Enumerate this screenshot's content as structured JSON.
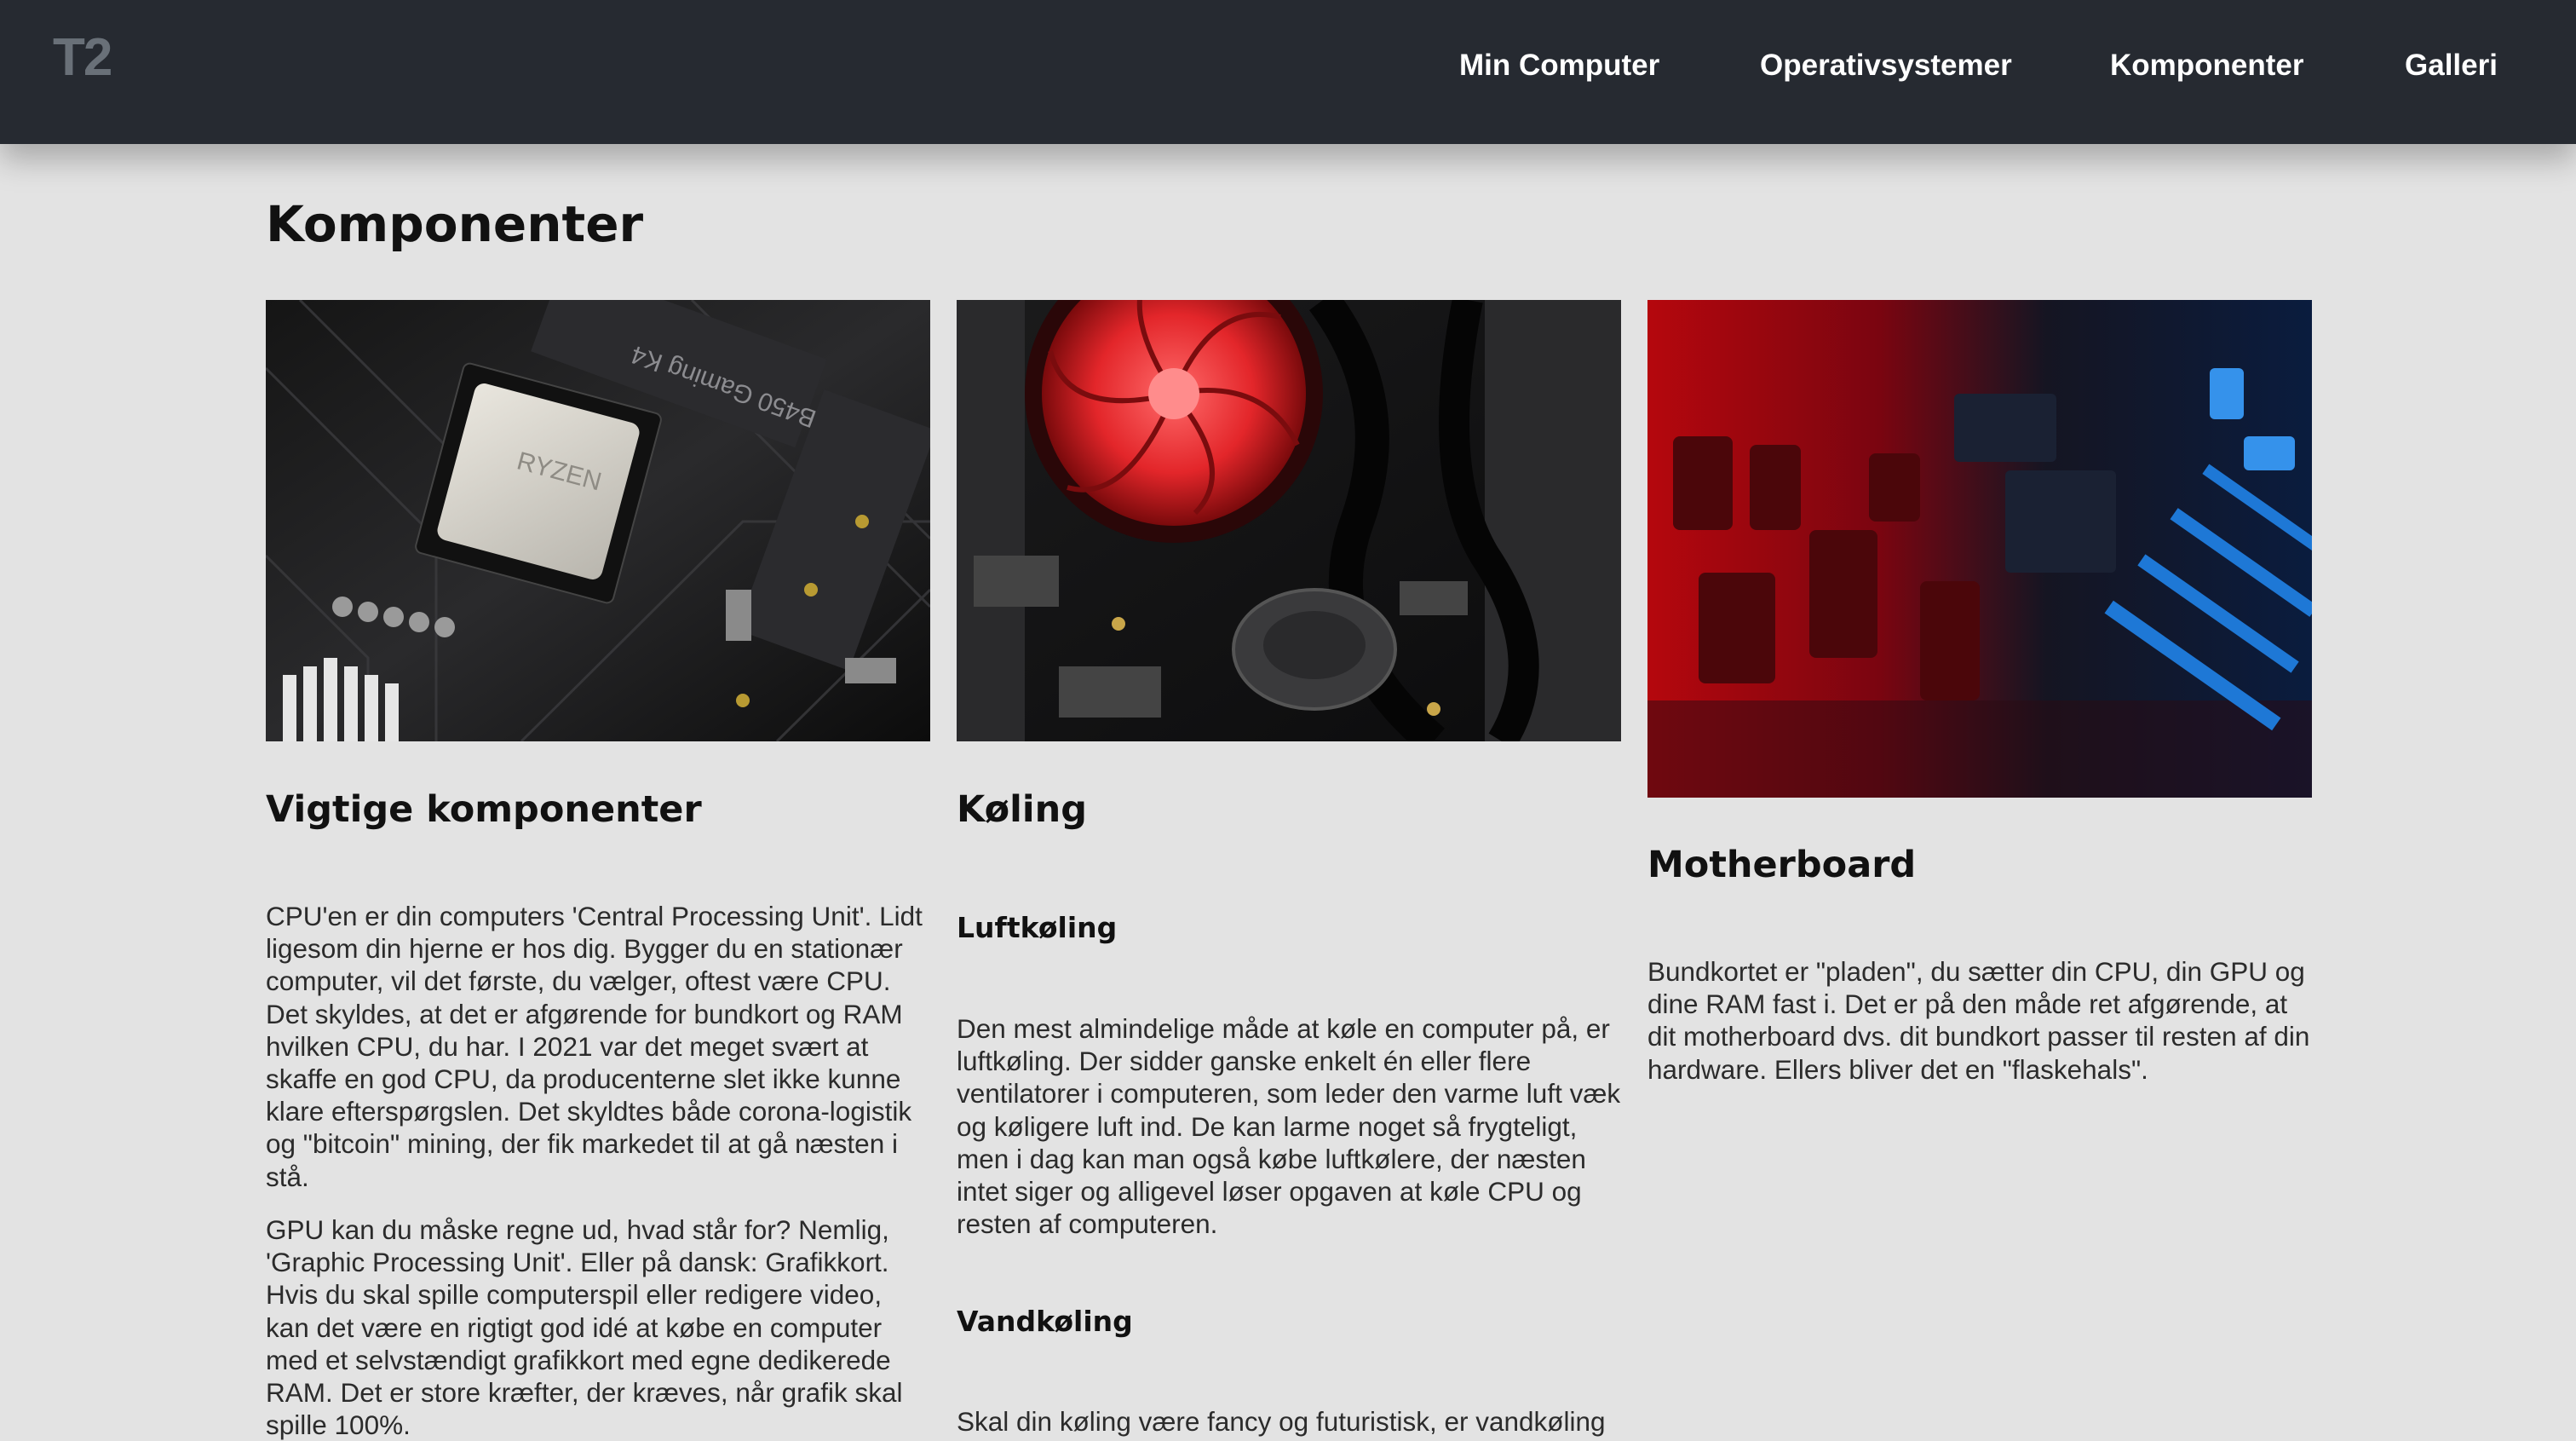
{
  "nav": {
    "logo": "T2",
    "links": [
      "Min Computer",
      "Operativsystemer",
      "Komponenter",
      "Galleri"
    ]
  },
  "page": {
    "title": "Komponenter"
  },
  "columns": [
    {
      "heading": "Vigtige komponenter",
      "paragraphs": [
        "CPU'en er din computers 'Central Processing Unit'. Lidt ligesom din hjerne er hos dig. Bygger du en stationær computer, vil det første, du vælger, oftest være CPU. Det skyldes, at det er afgørende for bundkort og RAM hvilken CPU, du har. I 2021 var det meget svært at skaffe en god CPU, da producenterne slet ikke kunne klare efterspørgslen. Det skyldtes både corona-logistik og \"bitcoin\" mining, der fik markedet til at gå næsten i stå.",
        "GPU kan du måske regne ud, hvad står for? Nemlig, 'Graphic Processing Unit'. Eller på dansk: Grafikkort. Hvis du skal spille computerspil eller redigere video, kan det være en rigtigt god idé at købe en computer med et selvstændigt grafikkort med egne dedikerede RAM. Det er store kræfter, der kræves, når grafik skal spille 100%."
      ]
    },
    {
      "heading": "Køling",
      "subsections": [
        {
          "heading": "Luftkøling",
          "text": "Den mest almindelige måde at køle en computer på, er luftkøling. Der sidder ganske enkelt én eller flere ventilatorer i computeren, som leder den varme luft væk og køligere luft ind. De kan larme noget så frygteligt, men i dag kan man også købe luftkølere, der næsten intet siger og alligevel løser opgaven at køle CPU og resten af computeren."
        },
        {
          "heading": "Vandkøling",
          "text": "Skal din køling være fancy og futuristisk, er vandkøling"
        }
      ]
    },
    {
      "heading": "Motherboard",
      "paragraphs": [
        "Bundkortet er \"pladen\", du sætter din CPU, din GPU og dine RAM fast i. Det er på den måde ret afgørende, at dit motherboard dvs. dit bundkort passer til resten af din hardware. Ellers bliver det en \"flaskehals\"."
      ]
    }
  ],
  "images": [
    {
      "icon": "cpu-motherboard-photo",
      "caption": "RYZEN",
      "board_text": "B450 Gaming K4"
    },
    {
      "icon": "red-cpu-cooler-fan-photo"
    },
    {
      "icon": "red-blue-circuit-board-photo"
    }
  ],
  "colors": {
    "nav_bg": "#262a31",
    "logo": "#697078",
    "page_bg": "#e3e3e3"
  }
}
